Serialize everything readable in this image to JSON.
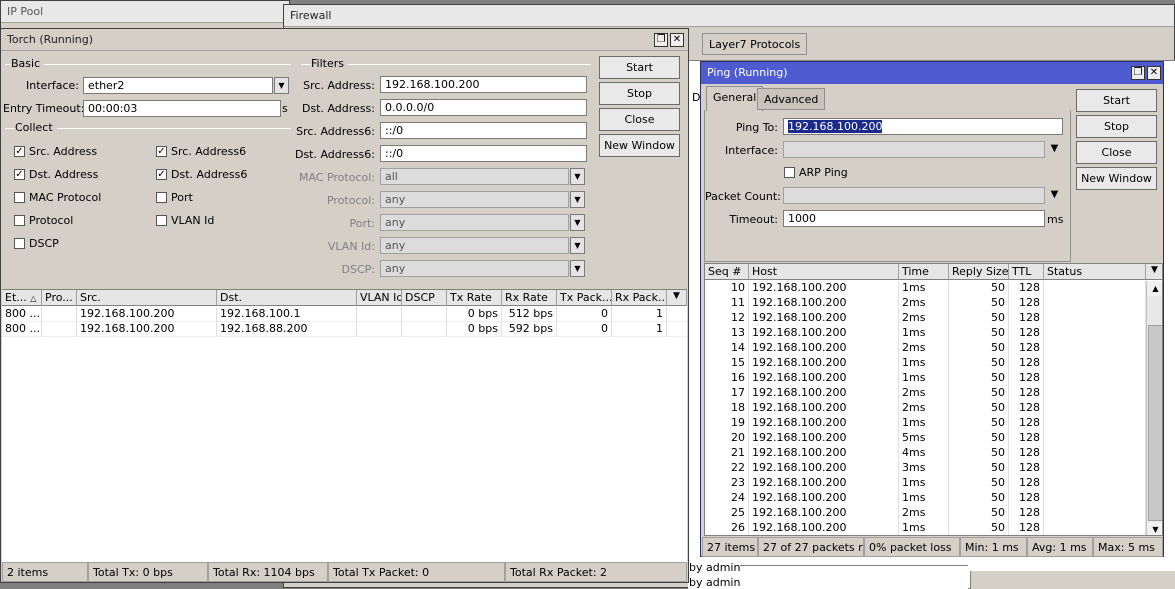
{
  "background_windows": {
    "ip_pool_title": "IP Pool",
    "firewall_title": "Firewall",
    "firewall_tab_fragment": "s",
    "firewall_tab": "Layer7 Protocols",
    "firewall_row_fragment_1": "D",
    "firewall_row_fragment_2": "by admin",
    "firewall_row_fragment_3": "by admin"
  },
  "torch": {
    "title": "Torch (Running)",
    "basic_label": "Basic",
    "interface_label": "Interface:",
    "interface_value": "ether2",
    "entry_timeout_label": "Entry Timeout:",
    "entry_timeout_value": "00:00:03",
    "entry_timeout_unit": "s",
    "collect_label": "Collect",
    "collect": [
      {
        "label": "Src. Address",
        "checked": true
      },
      {
        "label": "Dst. Address",
        "checked": true
      },
      {
        "label": "MAC Protocol",
        "checked": false
      },
      {
        "label": "Protocol",
        "checked": false
      },
      {
        "label": "DSCP",
        "checked": false
      },
      {
        "label": "Src. Address6",
        "checked": true
      },
      {
        "label": "Dst. Address6",
        "checked": true
      },
      {
        "label": "Port",
        "checked": false
      },
      {
        "label": "VLAN Id",
        "checked": false
      }
    ],
    "filters_label": "Filters",
    "filters": [
      {
        "label": "Src. Address:",
        "value": "192.168.100.200",
        "enabled": true
      },
      {
        "label": "Dst. Address:",
        "value": "0.0.0.0/0",
        "enabled": true
      },
      {
        "label": "Src. Address6:",
        "value": "::/0",
        "enabled": true
      },
      {
        "label": "Dst. Address6:",
        "value": "::/0",
        "enabled": true
      },
      {
        "label": "MAC Protocol:",
        "value": "all",
        "enabled": false
      },
      {
        "label": "Protocol:",
        "value": "any",
        "enabled": false
      },
      {
        "label": "Port:",
        "value": "any",
        "enabled": false
      },
      {
        "label": "VLAN Id:",
        "value": "any",
        "enabled": false
      },
      {
        "label": "DSCP:",
        "value": "any",
        "enabled": false
      }
    ],
    "buttons": {
      "start": "Start",
      "stop": "Stop",
      "close": "Close",
      "new_window": "New Window"
    },
    "columns": [
      "Et...",
      "Pro...",
      "Src.",
      "Dst.",
      "VLAN Id",
      "DSCP",
      "Tx Rate",
      "Rx Rate",
      "Tx Pack...",
      "Rx Pack..."
    ],
    "rows": [
      [
        "800 ...",
        "",
        "192.168.100.200",
        "192.168.100.1",
        "",
        "",
        "0 bps",
        "512 bps",
        "0",
        "1"
      ],
      [
        "800 ...",
        "",
        "192.168.100.200",
        "192.168.88.200",
        "",
        "",
        "0 bps",
        "592 bps",
        "0",
        "1"
      ]
    ],
    "status": [
      "2 items",
      "Total Tx: 0 bps",
      "Total Rx: 1104 bps",
      "Total Tx Packet: 0",
      "Total Rx Packet: 2"
    ]
  },
  "ping": {
    "title": "Ping (Running)",
    "tabs": [
      "General",
      "Advanced"
    ],
    "ping_to_label": "Ping To:",
    "ping_to_value": "192.168.100.200",
    "interface_label": "Interface:",
    "interface_value": "",
    "arp_ping_label": "ARP Ping",
    "arp_ping_checked": false,
    "packet_count_label": "Packet Count:",
    "packet_count_value": "",
    "timeout_label": "Timeout:",
    "timeout_value": "1000",
    "timeout_unit": "ms",
    "buttons": {
      "start": "Start",
      "stop": "Stop",
      "close": "Close",
      "new_window": "New Window"
    },
    "columns": [
      "Seq #",
      "Host",
      "Time",
      "Reply Size",
      "TTL",
      "Status"
    ],
    "rows": [
      [
        "10",
        "192.168.100.200",
        "1ms",
        "50",
        "128",
        ""
      ],
      [
        "11",
        "192.168.100.200",
        "2ms",
        "50",
        "128",
        ""
      ],
      [
        "12",
        "192.168.100.200",
        "2ms",
        "50",
        "128",
        ""
      ],
      [
        "13",
        "192.168.100.200",
        "1ms",
        "50",
        "128",
        ""
      ],
      [
        "14",
        "192.168.100.200",
        "2ms",
        "50",
        "128",
        ""
      ],
      [
        "15",
        "192.168.100.200",
        "1ms",
        "50",
        "128",
        ""
      ],
      [
        "16",
        "192.168.100.200",
        "1ms",
        "50",
        "128",
        ""
      ],
      [
        "17",
        "192.168.100.200",
        "2ms",
        "50",
        "128",
        ""
      ],
      [
        "18",
        "192.168.100.200",
        "2ms",
        "50",
        "128",
        ""
      ],
      [
        "19",
        "192.168.100.200",
        "1ms",
        "50",
        "128",
        ""
      ],
      [
        "20",
        "192.168.100.200",
        "5ms",
        "50",
        "128",
        ""
      ],
      [
        "21",
        "192.168.100.200",
        "4ms",
        "50",
        "128",
        ""
      ],
      [
        "22",
        "192.168.100.200",
        "3ms",
        "50",
        "128",
        ""
      ],
      [
        "23",
        "192.168.100.200",
        "1ms",
        "50",
        "128",
        ""
      ],
      [
        "24",
        "192.168.100.200",
        "1ms",
        "50",
        "128",
        ""
      ],
      [
        "25",
        "192.168.100.200",
        "2ms",
        "50",
        "128",
        ""
      ],
      [
        "26",
        "192.168.100.200",
        "1ms",
        "50",
        "128",
        ""
      ]
    ],
    "status": [
      "27 items",
      "27 of 27 packets r...",
      "0% packet loss",
      "Min: 1 ms",
      "Avg: 1 ms",
      "Max: 5 ms"
    ]
  },
  "glyphs": {
    "restore": "❐",
    "close": "✕",
    "dropdown": "▼",
    "check": "✓",
    "scroll_up": "▲",
    "scroll_down": "▼",
    "sort": "△"
  }
}
